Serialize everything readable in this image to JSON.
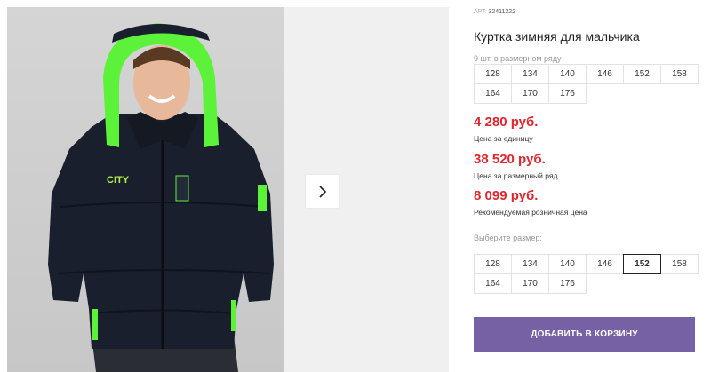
{
  "gallery": {
    "photo_alt": "Куртка зимняя для мальчика",
    "jacket_print": "CITY",
    "next_icon": "chevron-right-icon"
  },
  "product": {
    "article_label": "АРТ.",
    "article_number": "32411222",
    "title": "Куртка зимняя для мальчика",
    "size_row_note": "9 шт. в размерном ряду",
    "size_row": [
      "128",
      "134",
      "140",
      "146",
      "152",
      "158",
      "164",
      "170",
      "176"
    ]
  },
  "prices": {
    "unit_price": "4 280 руб.",
    "unit_label": "Цена за единицу",
    "row_price": "38 520 руб.",
    "row_label": "Цена за размерный ряд",
    "retail_price": "8 099 руб.",
    "retail_label": "Рекомендуемая розничная цена"
  },
  "size_picker": {
    "label": "Выберите размер:",
    "options": [
      "128",
      "134",
      "140",
      "146",
      "152",
      "158",
      "164",
      "170",
      "176"
    ],
    "selected": "152"
  },
  "actions": {
    "add_to_cart": "ДОБАВИТЬ В КОРЗИНУ"
  },
  "colors": {
    "accent": "#7561a4",
    "price": "#e0262f",
    "jacket": "#1a1f2e",
    "lining": "#5cf23a"
  }
}
